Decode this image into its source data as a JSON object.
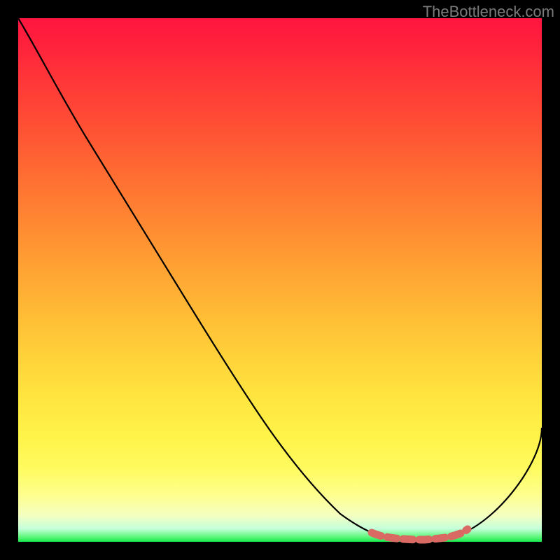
{
  "watermark": "TheBottleneck.com",
  "chart_data": {
    "type": "line",
    "title": "",
    "xlabel": "",
    "ylabel": "",
    "xlim": [
      0,
      100
    ],
    "ylim": [
      0,
      100
    ],
    "series": [
      {
        "name": "bottleneck-curve",
        "x": [
          0,
          5,
          10,
          15,
          20,
          25,
          30,
          35,
          40,
          45,
          50,
          55,
          60,
          65,
          70,
          75,
          80,
          85,
          90,
          95,
          100
        ],
        "y": [
          100,
          94,
          87,
          80,
          72,
          65,
          57,
          49,
          42,
          35,
          28,
          22,
          15,
          9,
          4,
          1,
          0,
          1,
          5,
          12,
          22
        ]
      },
      {
        "name": "optimal-range-marker",
        "x": [
          69,
          71,
          73,
          75,
          77,
          79,
          81,
          83,
          85
        ],
        "y": [
          1.5,
          1.2,
          1.0,
          0.9,
          0.9,
          0.9,
          1.0,
          1.3,
          1.8
        ]
      }
    ],
    "colors": {
      "curve": "#000000",
      "marker": "#d86a63",
      "background_top": "#ff163f",
      "background_bottom": "#17e84c"
    }
  }
}
